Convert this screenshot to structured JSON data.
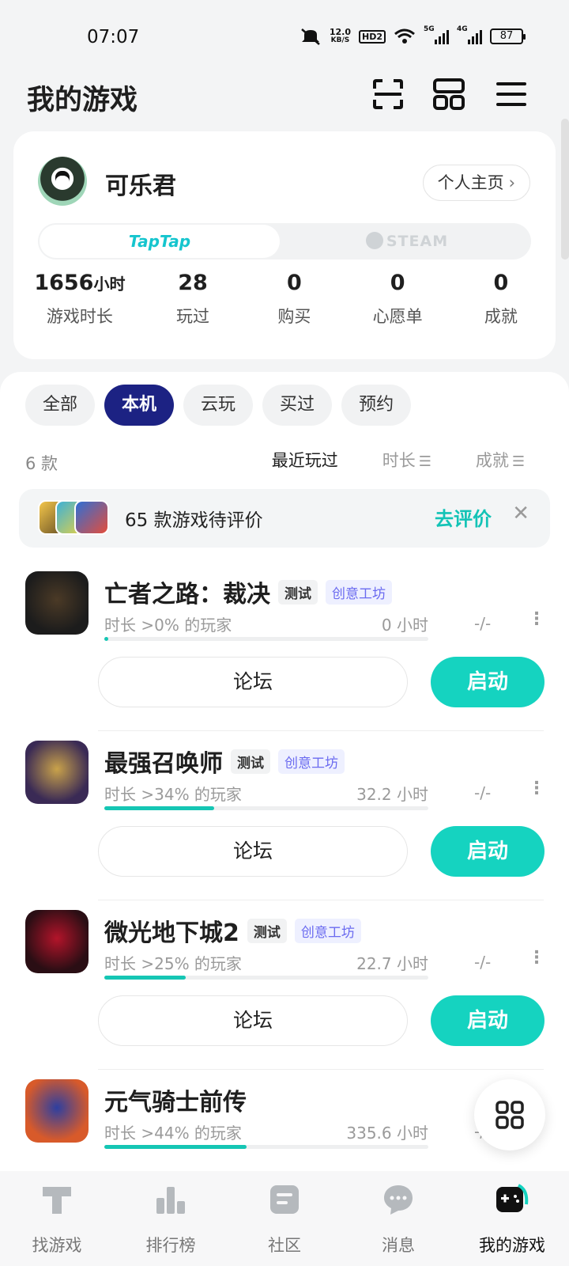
{
  "status_bar": {
    "time": "07:07",
    "net_speed": "12.0",
    "net_unit": "KB/S",
    "hd": "HD2",
    "sig1": "5G",
    "sig2": "4G",
    "battery": "87"
  },
  "header": {
    "title": "我的游戏"
  },
  "profile": {
    "username": "可乐君",
    "homepage_label": "个人主页",
    "platforms": [
      "TapTap",
      "STEAM"
    ],
    "stats": [
      {
        "value": "1656",
        "unit": "小时",
        "label": "游戏时长"
      },
      {
        "value": "28",
        "unit": "",
        "label": "玩过"
      },
      {
        "value": "0",
        "unit": "",
        "label": "购买"
      },
      {
        "value": "0",
        "unit": "",
        "label": "心愿单"
      },
      {
        "value": "0",
        "unit": "",
        "label": "成就"
      }
    ]
  },
  "filters": [
    "全部",
    "本机",
    "云玩",
    "买过",
    "预约"
  ],
  "active_filter": "本机",
  "count": "6 款",
  "sorts": {
    "recent": "最近玩过",
    "duration": "时长",
    "achievement": "成就"
  },
  "review_banner": {
    "text": "65 款游戏待评价",
    "action": "去评价",
    "close": "✕"
  },
  "games": [
    {
      "name": "亡者之路：裁决",
      "badge_test": "测试",
      "badge_cw": "创意工坊",
      "percentile": "时长 >0% 的玩家",
      "hours": "0 小时",
      "progress": 0.01,
      "achievement": "-/-",
      "forum": "论坛",
      "launch": "启动",
      "icon_colors": [
        "#1c1c1c",
        "#4b3a26"
      ]
    },
    {
      "name": "最强召唤师",
      "badge_test": "测试",
      "badge_cw": "创意工坊",
      "percentile": "时长 >34% 的玩家",
      "hours": "32.2 小时",
      "progress": 0.34,
      "achievement": "-/-",
      "forum": "论坛",
      "launch": "启动",
      "icon_colors": [
        "#3a2a55",
        "#c9a24a"
      ]
    },
    {
      "name": "微光地下城2",
      "badge_test": "测试",
      "badge_cw": "创意工坊",
      "percentile": "时长 >25% 的玩家",
      "hours": "22.7 小时",
      "progress": 0.25,
      "achievement": "-/-",
      "forum": "论坛",
      "launch": "启动",
      "icon_colors": [
        "#2a0e14",
        "#b3142a"
      ]
    },
    {
      "name": "元气骑士前传",
      "badge_test": "",
      "badge_cw": "",
      "percentile": "时长 >44% 的玩家",
      "hours": "335.6 小时",
      "progress": 0.44,
      "achievement": "-/-",
      "forum": "",
      "launch": "",
      "icon_colors": [
        "#d85a2a",
        "#2d3fa0"
      ]
    }
  ],
  "nav": [
    {
      "label": "找游戏",
      "icon": "find-game-icon",
      "active": false
    },
    {
      "label": "排行榜",
      "icon": "ranking-icon",
      "active": false
    },
    {
      "label": "社区",
      "icon": "community-icon",
      "active": false
    },
    {
      "label": "消息",
      "icon": "message-icon",
      "active": false
    },
    {
      "label": "我的游戏",
      "icon": "my-games-icon",
      "active": true
    }
  ],
  "colors": {
    "accent": "#15d3c0",
    "filter_active": "#1c2283",
    "taptap": "#15c5ce",
    "workshop": "#6b6bf0"
  }
}
